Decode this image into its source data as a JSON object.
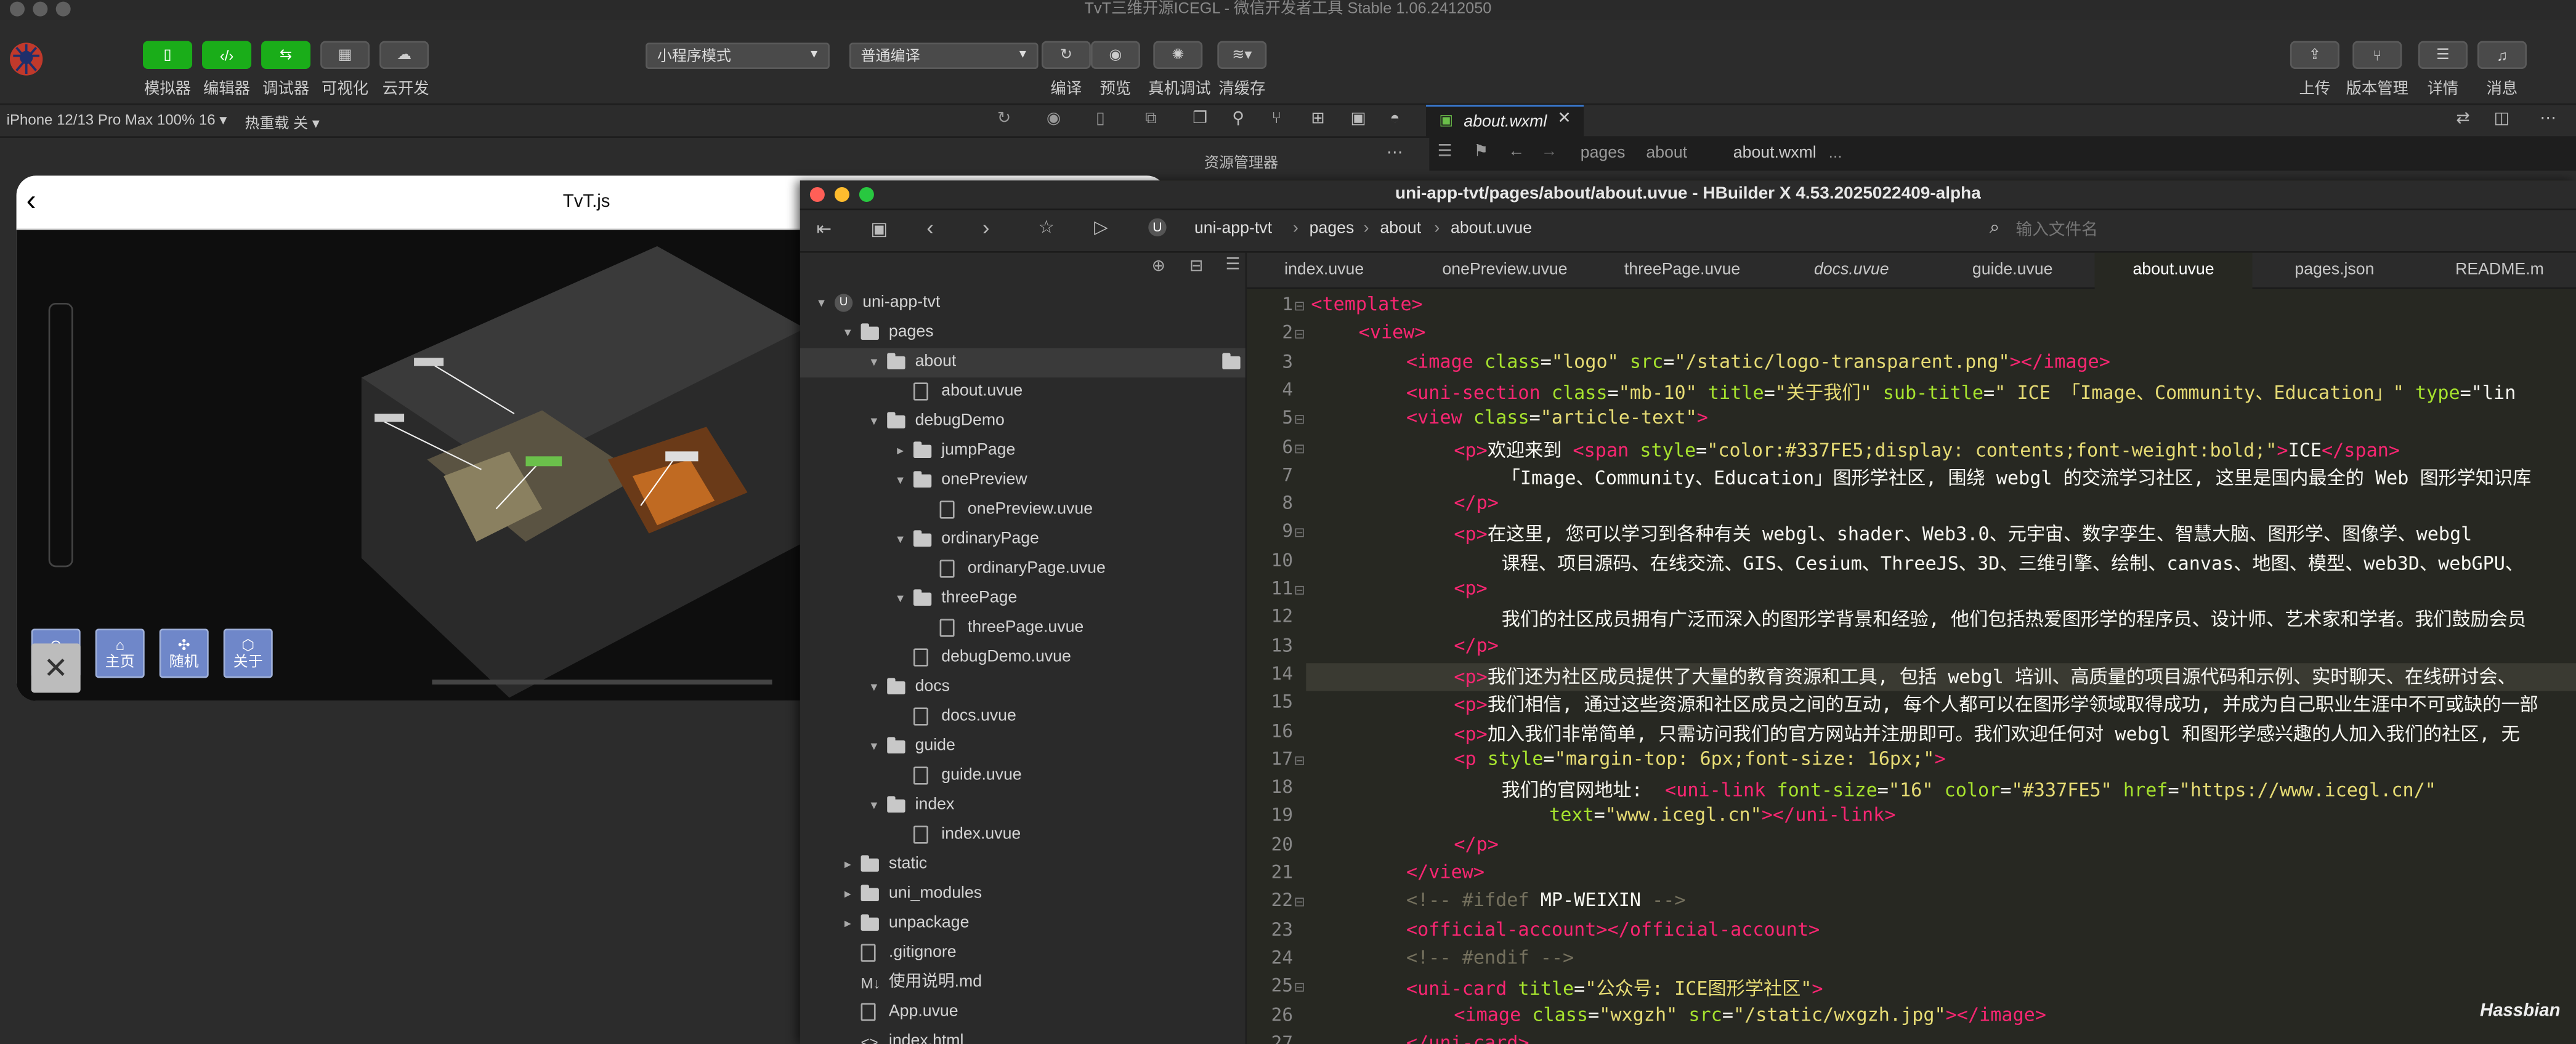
{
  "wx": {
    "window_title": "TvT三维开源ICEGL - 微信开发者工具 Stable 1.06.2412050",
    "toolbar": {
      "simulator": "模拟器",
      "editor": "编辑器",
      "debugger": "调试器",
      "visual": "可视化",
      "cloud": "云开发",
      "mode_select": "小程序模式",
      "compile_select": "普通编译",
      "compile": "编译",
      "preview": "预览",
      "real_debug": "真机调试",
      "clear_cache": "清缓存",
      "upload": "上传",
      "version": "版本管理",
      "details": "详情",
      "messages": "消息"
    },
    "device": "iPhone 12/13 Pro Max 100% 16 ▾",
    "hot_reload": "热重载 关 ▾",
    "phone": {
      "title": "TvT.js",
      "buttons": [
        "返回",
        "主页",
        "随机",
        "关于"
      ]
    },
    "right": {
      "tab_file": "about.wxml",
      "resource_manager": "资源管理器",
      "crumbs": [
        "pages",
        "about",
        "about.wxml",
        "..."
      ]
    }
  },
  "hb": {
    "window_title": "uni-app-tvt/pages/about/about.uvue - HBuilder X 4.53.2025022409-alpha",
    "crumbs": [
      "uni-app-tvt",
      "pages",
      "about",
      "about.uvue"
    ],
    "search_placeholder": "输入文件名",
    "tree": [
      {
        "label": "uni-app-tvt",
        "indent": 0,
        "kind": "project",
        "chev": "⌄"
      },
      {
        "label": "pages",
        "indent": 1,
        "kind": "folder",
        "chev": "⌄"
      },
      {
        "label": "about",
        "indent": 2,
        "kind": "folder",
        "chev": "⌄",
        "active": true
      },
      {
        "label": "about.uvue",
        "indent": 3,
        "kind": "file"
      },
      {
        "label": "debugDemo",
        "indent": 2,
        "kind": "folder",
        "chev": "⌄"
      },
      {
        "label": "jumpPage",
        "indent": 3,
        "kind": "folder",
        "chev": "›"
      },
      {
        "label": "onePreview",
        "indent": 3,
        "kind": "folder",
        "chev": "⌄"
      },
      {
        "label": "onePreview.uvue",
        "indent": 4,
        "kind": "file"
      },
      {
        "label": "ordinaryPage",
        "indent": 3,
        "kind": "folder",
        "chev": "⌄"
      },
      {
        "label": "ordinaryPage.uvue",
        "indent": 4,
        "kind": "file"
      },
      {
        "label": "threePage",
        "indent": 3,
        "kind": "folder",
        "chev": "⌄"
      },
      {
        "label": "threePage.uvue",
        "indent": 4,
        "kind": "file"
      },
      {
        "label": "debugDemo.uvue",
        "indent": 3,
        "kind": "file"
      },
      {
        "label": "docs",
        "indent": 2,
        "kind": "folder",
        "chev": "⌄"
      },
      {
        "label": "docs.uvue",
        "indent": 3,
        "kind": "file"
      },
      {
        "label": "guide",
        "indent": 2,
        "kind": "folder",
        "chev": "⌄"
      },
      {
        "label": "guide.uvue",
        "indent": 3,
        "kind": "file"
      },
      {
        "label": "index",
        "indent": 2,
        "kind": "folder",
        "chev": "⌄"
      },
      {
        "label": "index.uvue",
        "indent": 3,
        "kind": "file"
      },
      {
        "label": "static",
        "indent": 1,
        "kind": "folder",
        "chev": "›"
      },
      {
        "label": "uni_modules",
        "indent": 1,
        "kind": "folder",
        "chev": "›"
      },
      {
        "label": "unpackage",
        "indent": 1,
        "kind": "folder",
        "chev": "›"
      },
      {
        "label": ".gitignore",
        "indent": 1,
        "kind": "file"
      },
      {
        "label": "使用说明.md",
        "indent": 1,
        "kind": "md"
      },
      {
        "label": "App.uvue",
        "indent": 1,
        "kind": "file"
      },
      {
        "label": "index.html",
        "indent": 1,
        "kind": "html"
      }
    ],
    "tabs": [
      "index.uvue",
      "onePreview.uvue",
      "threePage.uvue",
      "docs.uvue",
      "guide.uvue",
      "about.uvue",
      "pages.json",
      "README.m"
    ],
    "active_tab": "about.uvue",
    "code": [
      [
        0,
        "⊟",
        [
          [
            "tag",
            "<template>"
          ]
        ]
      ],
      [
        1,
        "⊟",
        [
          [
            "tag",
            "<view>"
          ]
        ]
      ],
      [
        2,
        "",
        [
          [
            "tag",
            "<image "
          ],
          [
            "attr",
            "class"
          ],
          [
            "txt",
            "="
          ],
          [
            "str",
            "\"logo\" "
          ],
          [
            "attr",
            "src"
          ],
          [
            "txt",
            "="
          ],
          [
            "str",
            "\"/static/logo-transparent.png\""
          ],
          [
            "tag",
            "></image>"
          ]
        ]
      ],
      [
        2,
        "",
        [
          [
            "tag",
            "<uni-section "
          ],
          [
            "attr",
            "class"
          ],
          [
            "txt",
            "="
          ],
          [
            "str",
            "\"mb-10\" "
          ],
          [
            "attr",
            "title"
          ],
          [
            "txt",
            "="
          ],
          [
            "str",
            "\"关于我们\" "
          ],
          [
            "attr",
            "sub-title"
          ],
          [
            "txt",
            "="
          ],
          [
            "str",
            "\" ICE 「Image、Community、Education」\" "
          ],
          [
            "attr",
            "type"
          ],
          [
            "txt",
            "=\"lin"
          ]
        ]
      ],
      [
        2,
        "⊟",
        [
          [
            "tag",
            "<view "
          ],
          [
            "attr",
            "class"
          ],
          [
            "txt",
            "="
          ],
          [
            "str",
            "\"article-text\""
          ],
          [
            "tag",
            ">"
          ]
        ]
      ],
      [
        3,
        "⊟",
        [
          [
            "tag",
            "<p"
          ],
          [
            "tag",
            ">"
          ],
          [
            "txt",
            "欢迎来到 "
          ],
          [
            "tag",
            "<span "
          ],
          [
            "attr",
            "style"
          ],
          [
            "txt",
            "="
          ],
          [
            "str",
            "\"color:#337FE5;display: contents;font-weight:bold;\""
          ],
          [
            "tag",
            ">"
          ],
          [
            "txt",
            "ICE"
          ],
          [
            "tag",
            "</span>"
          ]
        ]
      ],
      [
        4,
        "",
        [
          [
            "txt",
            "「Image、Community、Education」图形学社区, 围绕 webgl 的交流学习社区, 这里是国内最全的 Web 图形学知识库"
          ]
        ]
      ],
      [
        3,
        "",
        [
          [
            "tag",
            "</p>"
          ]
        ]
      ],
      [
        3,
        "⊟",
        [
          [
            "tag",
            "<p"
          ],
          [
            "tag",
            ">"
          ],
          [
            "txt",
            "在这里, 您可以学习到各种有关 webgl、shader、Web3.0、元宇宙、数字孪生、智慧大脑、图形学、图像学、webgl"
          ]
        ]
      ],
      [
        4,
        "",
        [
          [
            "txt",
            "课程、项目源码、在线交流、GIS、Cesium、ThreeJS、3D、三维引擎、绘制、canvas、地图、模型、web3D、webGPU、"
          ]
        ]
      ],
      [
        3,
        "⊟",
        [
          [
            "tag",
            "<p"
          ],
          [
            "tag",
            ">"
          ]
        ]
      ],
      [
        4,
        "",
        [
          [
            "txt",
            "我们的社区成员拥有广泛而深入的图形学背景和经验, 他们包括热爱图形学的程序员、设计师、艺术家和学者。我们鼓励会员"
          ]
        ]
      ],
      [
        3,
        "",
        [
          [
            "tag",
            "</p>"
          ]
        ]
      ],
      [
        3,
        "",
        [
          [
            "tag",
            "<p"
          ],
          [
            "tag",
            ">"
          ],
          [
            "txt",
            "我们还为社区成员提供了大量的教育资源和工具, 包括 webgl 培训、高质量的项目源代码和示例、实时聊天、在线研讨会、"
          ]
        ]
      ],
      [
        3,
        "",
        [
          [
            "tag",
            "<p"
          ],
          [
            "tag",
            ">"
          ],
          [
            "txt",
            "我们相信, 通过这些资源和社区成员之间的互动, 每个人都可以在图形学领域取得成功, 并成为自己职业生涯中不可或缺的一部"
          ]
        ]
      ],
      [
        3,
        "",
        [
          [
            "tag",
            "<p"
          ],
          [
            "tag",
            ">"
          ],
          [
            "txt",
            "加入我们非常简单, 只需访问我们的官方网站并注册即可。我们欢迎任何对 webgl 和图形学感兴趣的人加入我们的社区, 无"
          ]
        ]
      ],
      [
        3,
        "⊟",
        [
          [
            "tag",
            "<p "
          ],
          [
            "attr",
            "style"
          ],
          [
            "txt",
            "="
          ],
          [
            "str",
            "\"margin-top: 6px;font-size: 16px;\""
          ],
          [
            "tag",
            ">"
          ]
        ]
      ],
      [
        4,
        "",
        [
          [
            "txt",
            "我们的官网地址:  "
          ],
          [
            "tag",
            "<uni-link "
          ],
          [
            "attr",
            "font-size"
          ],
          [
            "txt",
            "="
          ],
          [
            "str",
            "\"16\" "
          ],
          [
            "attr",
            "color"
          ],
          [
            "txt",
            "="
          ],
          [
            "str",
            "\"#337FE5\" "
          ],
          [
            "attr",
            "href"
          ],
          [
            "txt",
            "="
          ],
          [
            "str",
            "\"https://www.icegl.cn/\""
          ]
        ]
      ],
      [
        5,
        "",
        [
          [
            "attr",
            "text"
          ],
          [
            "txt",
            "="
          ],
          [
            "str",
            "\"www.icegl.cn\""
          ],
          [
            "tag",
            "></uni-link>"
          ]
        ]
      ],
      [
        3,
        "",
        [
          [
            "tag",
            "</p>"
          ]
        ]
      ],
      [
        2,
        "",
        [
          [
            "tag",
            "</view>"
          ]
        ]
      ],
      [
        2,
        "⊟",
        [
          [
            "com",
            "<!-- #ifdef "
          ],
          [
            "txt",
            "MP-WEIXIN "
          ],
          [
            "com",
            "-->"
          ]
        ]
      ],
      [
        2,
        "",
        [
          [
            "tag",
            "<official-account></official-account>"
          ]
        ]
      ],
      [
        2,
        "",
        [
          [
            "com",
            "<!-- #endif -->"
          ]
        ]
      ],
      [
        2,
        "⊟",
        [
          [
            "tag",
            "<uni-card "
          ],
          [
            "attr",
            "title"
          ],
          [
            "txt",
            "="
          ],
          [
            "str",
            "\"公众号: ICE图形学社区\""
          ],
          [
            "tag",
            ">"
          ]
        ]
      ],
      [
        3,
        "",
        [
          [
            "tag",
            "<image "
          ],
          [
            "attr",
            "class"
          ],
          [
            "txt",
            "="
          ],
          [
            "str",
            "\"wxgzh\" "
          ],
          [
            "attr",
            "src"
          ],
          [
            "txt",
            "="
          ],
          [
            "str",
            "\"/static/wxgzh.jpg\""
          ],
          [
            "tag",
            "></image>"
          ]
        ]
      ],
      [
        2,
        "",
        [
          [
            "tag",
            "</uni-card>"
          ]
        ]
      ]
    ]
  },
  "watermark": "Hassbian"
}
